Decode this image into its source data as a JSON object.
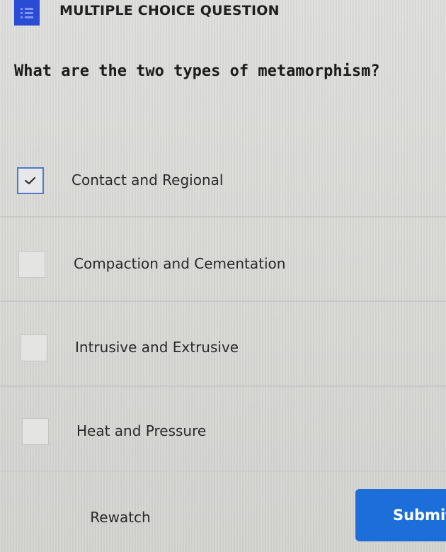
{
  "header": {
    "type_icon": "list-icon",
    "type_label": "MULTIPLE CHOICE QUESTION",
    "accent_color": "#2a4bd6"
  },
  "question": {
    "text": "What are the two types of metamorphism?"
  },
  "options": [
    {
      "label": "Contact and Regional",
      "checked": true
    },
    {
      "label": "Compaction and Cementation",
      "checked": false
    },
    {
      "label": "Intrusive and Extrusive",
      "checked": false
    },
    {
      "label": "Heat and Pressure",
      "checked": false
    }
  ],
  "actions": {
    "rewatch_label": "Rewatch",
    "submit_label": "Submit",
    "submit_color": "#1c6fd8"
  }
}
